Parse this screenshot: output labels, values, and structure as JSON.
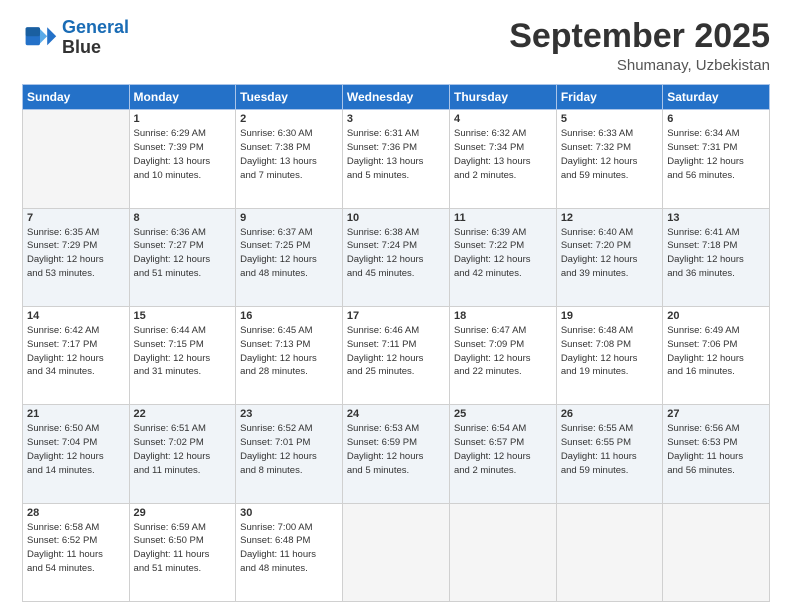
{
  "header": {
    "logo_line1": "General",
    "logo_line2": "Blue",
    "month": "September 2025",
    "location": "Shumanay, Uzbekistan"
  },
  "days_of_week": [
    "Sunday",
    "Monday",
    "Tuesday",
    "Wednesday",
    "Thursday",
    "Friday",
    "Saturday"
  ],
  "weeks": [
    [
      {
        "num": "",
        "detail": ""
      },
      {
        "num": "1",
        "detail": "Sunrise: 6:29 AM\nSunset: 7:39 PM\nDaylight: 13 hours\nand 10 minutes."
      },
      {
        "num": "2",
        "detail": "Sunrise: 6:30 AM\nSunset: 7:38 PM\nDaylight: 13 hours\nand 7 minutes."
      },
      {
        "num": "3",
        "detail": "Sunrise: 6:31 AM\nSunset: 7:36 PM\nDaylight: 13 hours\nand 5 minutes."
      },
      {
        "num": "4",
        "detail": "Sunrise: 6:32 AM\nSunset: 7:34 PM\nDaylight: 13 hours\nand 2 minutes."
      },
      {
        "num": "5",
        "detail": "Sunrise: 6:33 AM\nSunset: 7:32 PM\nDaylight: 12 hours\nand 59 minutes."
      },
      {
        "num": "6",
        "detail": "Sunrise: 6:34 AM\nSunset: 7:31 PM\nDaylight: 12 hours\nand 56 minutes."
      }
    ],
    [
      {
        "num": "7",
        "detail": "Sunrise: 6:35 AM\nSunset: 7:29 PM\nDaylight: 12 hours\nand 53 minutes."
      },
      {
        "num": "8",
        "detail": "Sunrise: 6:36 AM\nSunset: 7:27 PM\nDaylight: 12 hours\nand 51 minutes."
      },
      {
        "num": "9",
        "detail": "Sunrise: 6:37 AM\nSunset: 7:25 PM\nDaylight: 12 hours\nand 48 minutes."
      },
      {
        "num": "10",
        "detail": "Sunrise: 6:38 AM\nSunset: 7:24 PM\nDaylight: 12 hours\nand 45 minutes."
      },
      {
        "num": "11",
        "detail": "Sunrise: 6:39 AM\nSunset: 7:22 PM\nDaylight: 12 hours\nand 42 minutes."
      },
      {
        "num": "12",
        "detail": "Sunrise: 6:40 AM\nSunset: 7:20 PM\nDaylight: 12 hours\nand 39 minutes."
      },
      {
        "num": "13",
        "detail": "Sunrise: 6:41 AM\nSunset: 7:18 PM\nDaylight: 12 hours\nand 36 minutes."
      }
    ],
    [
      {
        "num": "14",
        "detail": "Sunrise: 6:42 AM\nSunset: 7:17 PM\nDaylight: 12 hours\nand 34 minutes."
      },
      {
        "num": "15",
        "detail": "Sunrise: 6:44 AM\nSunset: 7:15 PM\nDaylight: 12 hours\nand 31 minutes."
      },
      {
        "num": "16",
        "detail": "Sunrise: 6:45 AM\nSunset: 7:13 PM\nDaylight: 12 hours\nand 28 minutes."
      },
      {
        "num": "17",
        "detail": "Sunrise: 6:46 AM\nSunset: 7:11 PM\nDaylight: 12 hours\nand 25 minutes."
      },
      {
        "num": "18",
        "detail": "Sunrise: 6:47 AM\nSunset: 7:09 PM\nDaylight: 12 hours\nand 22 minutes."
      },
      {
        "num": "19",
        "detail": "Sunrise: 6:48 AM\nSunset: 7:08 PM\nDaylight: 12 hours\nand 19 minutes."
      },
      {
        "num": "20",
        "detail": "Sunrise: 6:49 AM\nSunset: 7:06 PM\nDaylight: 12 hours\nand 16 minutes."
      }
    ],
    [
      {
        "num": "21",
        "detail": "Sunrise: 6:50 AM\nSunset: 7:04 PM\nDaylight: 12 hours\nand 14 minutes."
      },
      {
        "num": "22",
        "detail": "Sunrise: 6:51 AM\nSunset: 7:02 PM\nDaylight: 12 hours\nand 11 minutes."
      },
      {
        "num": "23",
        "detail": "Sunrise: 6:52 AM\nSunset: 7:01 PM\nDaylight: 12 hours\nand 8 minutes."
      },
      {
        "num": "24",
        "detail": "Sunrise: 6:53 AM\nSunset: 6:59 PM\nDaylight: 12 hours\nand 5 minutes."
      },
      {
        "num": "25",
        "detail": "Sunrise: 6:54 AM\nSunset: 6:57 PM\nDaylight: 12 hours\nand 2 minutes."
      },
      {
        "num": "26",
        "detail": "Sunrise: 6:55 AM\nSunset: 6:55 PM\nDaylight: 11 hours\nand 59 minutes."
      },
      {
        "num": "27",
        "detail": "Sunrise: 6:56 AM\nSunset: 6:53 PM\nDaylight: 11 hours\nand 56 minutes."
      }
    ],
    [
      {
        "num": "28",
        "detail": "Sunrise: 6:58 AM\nSunset: 6:52 PM\nDaylight: 11 hours\nand 54 minutes."
      },
      {
        "num": "29",
        "detail": "Sunrise: 6:59 AM\nSunset: 6:50 PM\nDaylight: 11 hours\nand 51 minutes."
      },
      {
        "num": "30",
        "detail": "Sunrise: 7:00 AM\nSunset: 6:48 PM\nDaylight: 11 hours\nand 48 minutes."
      },
      {
        "num": "",
        "detail": ""
      },
      {
        "num": "",
        "detail": ""
      },
      {
        "num": "",
        "detail": ""
      },
      {
        "num": "",
        "detail": ""
      }
    ]
  ]
}
